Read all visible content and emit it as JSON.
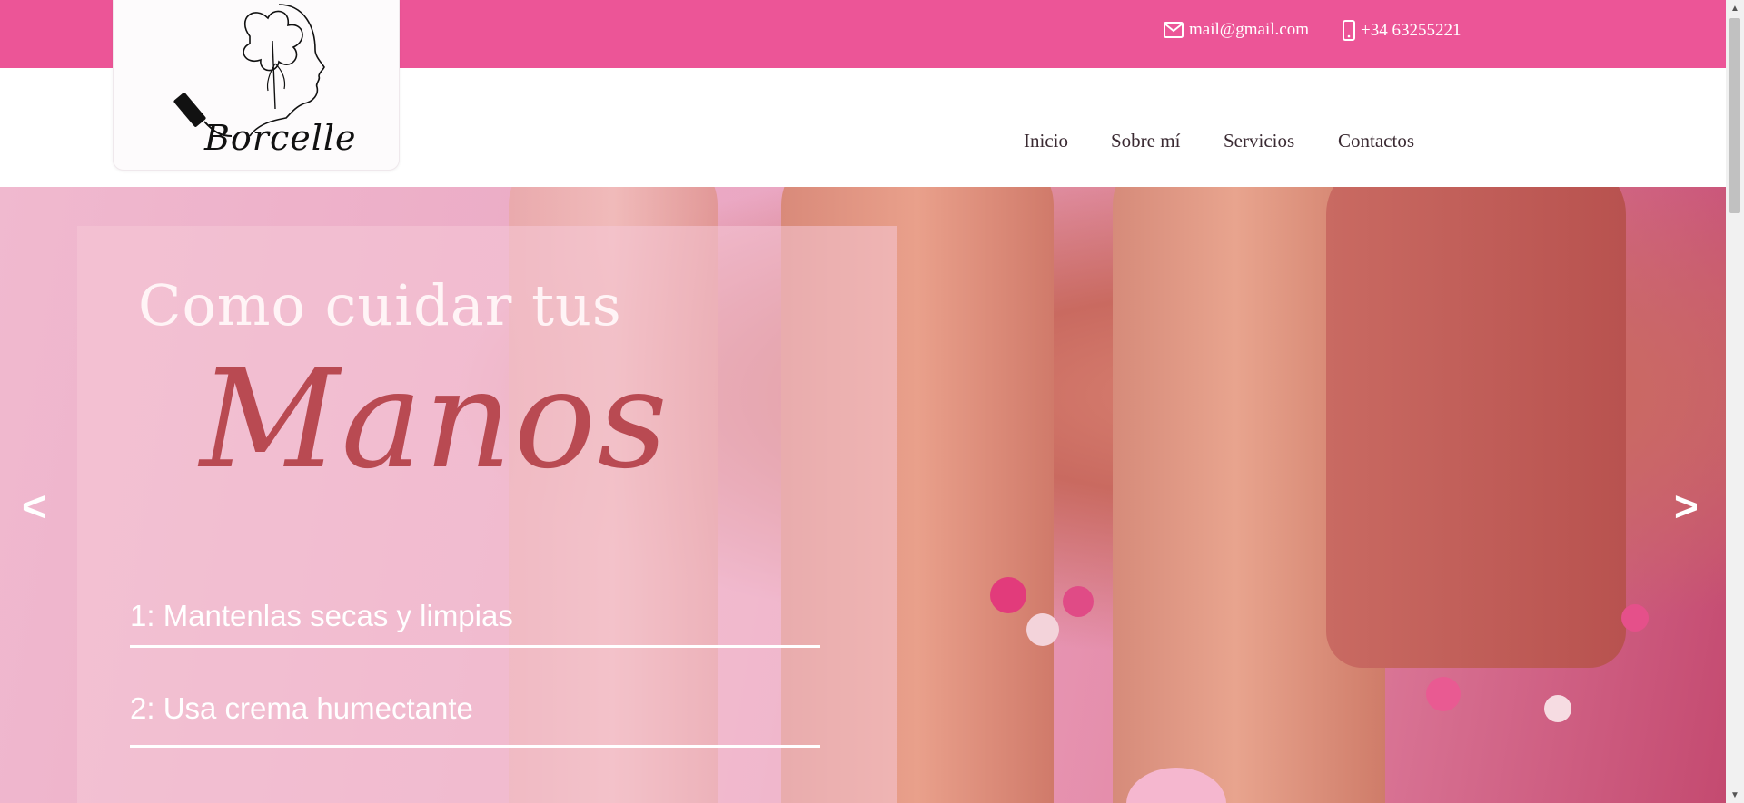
{
  "topbar": {
    "email": "mail@gmail.com",
    "phone": "+34 63255221",
    "email_icon": "envelope-icon",
    "phone_icon": "mobile-phone-icon",
    "color": "#ec5597"
  },
  "brand": {
    "logo_text": "Borcelle"
  },
  "nav": {
    "items": [
      {
        "label": "Inicio"
      },
      {
        "label": "Sobre mí"
      },
      {
        "label": "Servicios"
      },
      {
        "label": "Contactos"
      }
    ]
  },
  "hero": {
    "title": "Como cuidar tus",
    "script_word": "Manos",
    "tips": [
      "1: Mantenlas  secas y limpias",
      "2: Usa crema humectante"
    ],
    "prev_label": "<",
    "next_label": ">",
    "accent_color": "#b94a52"
  }
}
